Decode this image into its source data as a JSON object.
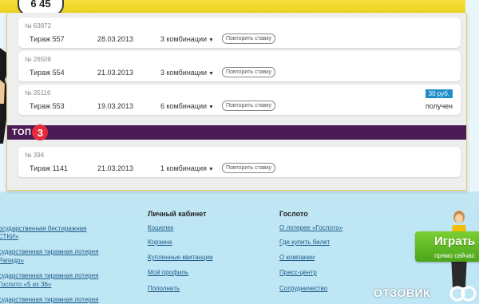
{
  "header": {
    "logo_text": "6 45"
  },
  "tickets": [
    {
      "number": "№ 63872",
      "draw": "Тираж 557",
      "date": "28.03.2013",
      "combinations": "3 комбинации",
      "repeat": "Повторить ставку"
    },
    {
      "number": "№ 26508",
      "draw": "Тираж 554",
      "date": "21.03.2013",
      "combinations": "3 комбинации",
      "repeat": "Повторить ставку"
    },
    {
      "number": "№ 35116",
      "draw": "Тираж 553",
      "date": "19.03.2013",
      "combinations": "6 комбинации",
      "repeat": "Повторить ставку",
      "badge": "30 руб.",
      "status": "получен"
    }
  ],
  "top3": {
    "logo_text": "ТОП",
    "logo_number": "3",
    "tickets": [
      {
        "number": "№ 394",
        "draw": "Тираж 1141",
        "date": "21.03.2013",
        "combinations": "1 комбинация",
        "repeat": "Повторить ставку"
      }
    ]
  },
  "footer": {
    "left_links": [
      "осударственная бестиражная",
      "СТКИ»",
      "сударственная тиражная лотерея",
      "Рапидо»",
      "сударственная тиражная лотерея",
      "Гослото «5 из 36»",
      "сударственная тиражная лотерея"
    ],
    "cabinet": {
      "title": "Личный кабинет",
      "links": [
        "Кошелек",
        "Корзина",
        "Купленные квитанции",
        "Мой профиль",
        "Пополнить"
      ]
    },
    "gosloto": {
      "title": "Гослото",
      "links": [
        "О лотерее «Гослото»",
        "Где купить билет",
        "О компании",
        "Пресс-центр",
        "Сотрудничество"
      ]
    }
  },
  "play_button": {
    "label": "Играть",
    "sublabel": "прямо сейчас"
  },
  "watermark": "ОТЗОВИК",
  "colors": {
    "top3_bar": "#4b1b55",
    "badge": "#1f8ec8",
    "play_button": "#5cb923",
    "header_strip": "#f0d52a"
  }
}
